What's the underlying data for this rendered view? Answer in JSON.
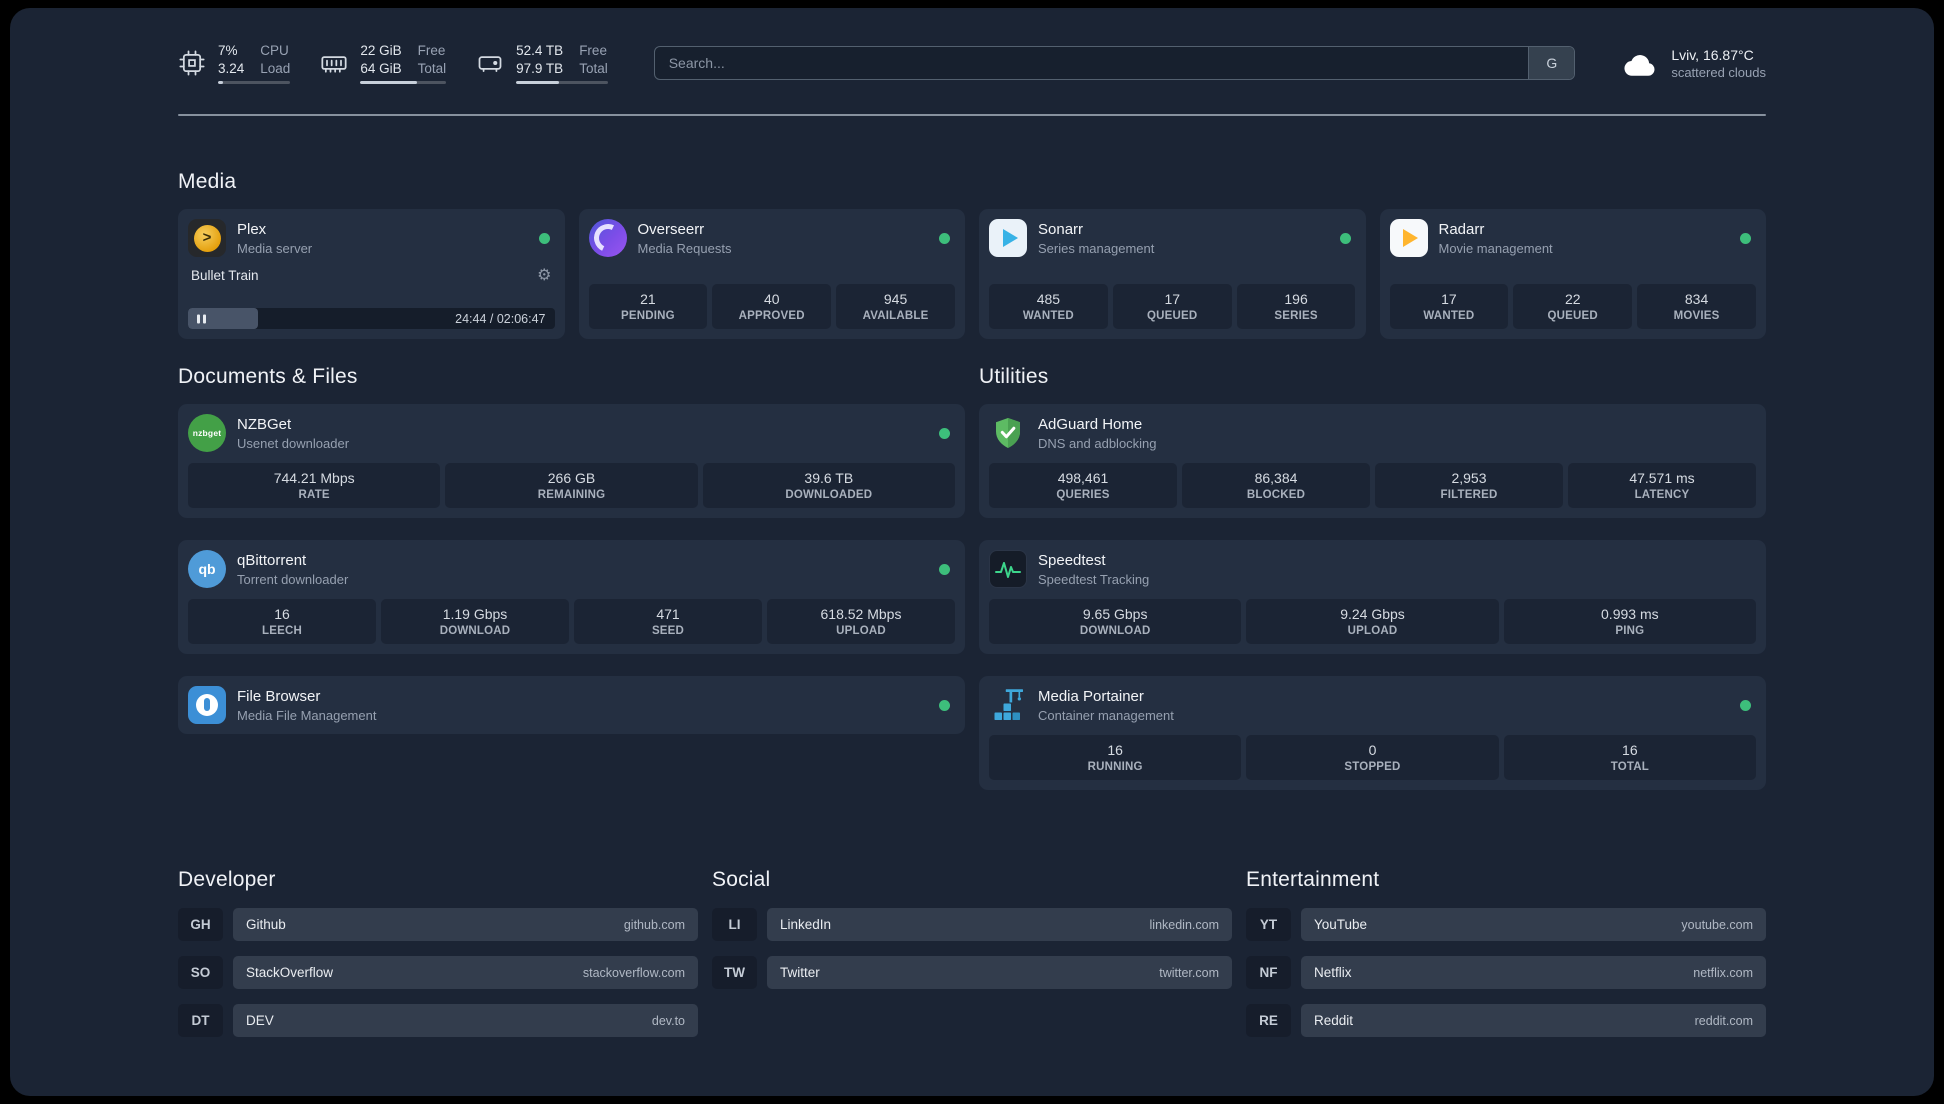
{
  "colors": {
    "background": "#1B2434",
    "card": "#242F41",
    "tile": "#1B2434",
    "status_online": "#3DBE7B",
    "plex_accent": "#E5A00D",
    "sonarr_accent": "#37B2E6",
    "radarr_accent": "#FFB52E",
    "overseerr_accent": "#7C4DE8",
    "nzbget_accent": "#43A047",
    "qbittorrent_accent": "#4F9BD8",
    "filebrowser_accent": "#3C8FD6",
    "adguard_accent": "#5DBB63",
    "speedtest_accent": "#3DD68C",
    "portainer_accent": "#3EA8DC"
  },
  "icons": {
    "settings_glyph": "⚙"
  },
  "topbar": {
    "cpu": {
      "value1": "7%",
      "label1": "CPU",
      "value2": "3.24",
      "label2": "Load",
      "usage_percent": 7
    },
    "memory": {
      "value1": "22 GiB",
      "label1": "Free",
      "value2": "64 GiB",
      "label2": "Total",
      "usage_percent": 66
    },
    "disk": {
      "value1": "52.4 TB",
      "label1": "Free",
      "value2": "97.9 TB",
      "label2": "Total",
      "usage_percent": 47
    },
    "search": {
      "placeholder": "Search...",
      "provider_label": "G"
    },
    "weather": {
      "location": "Lviv, 16.87°C",
      "condition": "scattered clouds"
    }
  },
  "section_titles": {
    "media": "Media",
    "documents": "Documents & Files",
    "utilities": "Utilities",
    "developer": "Developer",
    "social": "Social",
    "entertainment": "Entertainment"
  },
  "services": {
    "plex": {
      "name": "Plex",
      "desc": "Media server",
      "status": "online",
      "icon_text": ">",
      "now_playing": "Bullet Train",
      "time": "24:44 / 02:06:47",
      "progress_percent": 19
    },
    "overseerr": {
      "name": "Overseerr",
      "desc": "Media Requests",
      "status": "online",
      "stats": [
        {
          "value": "21",
          "label": "PENDING"
        },
        {
          "value": "40",
          "label": "APPROVED"
        },
        {
          "value": "945",
          "label": "AVAILABLE"
        }
      ]
    },
    "sonarr": {
      "name": "Sonarr",
      "desc": "Series management",
      "status": "online",
      "stats": [
        {
          "value": "485",
          "label": "WANTED"
        },
        {
          "value": "17",
          "label": "QUEUED"
        },
        {
          "value": "196",
          "label": "SERIES"
        }
      ]
    },
    "radarr": {
      "name": "Radarr",
      "desc": "Movie management",
      "status": "online",
      "stats": [
        {
          "value": "17",
          "label": "WANTED"
        },
        {
          "value": "22",
          "label": "QUEUED"
        },
        {
          "value": "834",
          "label": "MOVIES"
        }
      ]
    },
    "nzbget": {
      "name": "NZBGet",
      "desc": "Usenet downloader",
      "status": "online",
      "icon_text": "nzbget",
      "stats": [
        {
          "value": "744.21 Mbps",
          "label": "RATE"
        },
        {
          "value": "266 GB",
          "label": "REMAINING"
        },
        {
          "value": "39.6 TB",
          "label": "DOWNLOADED"
        }
      ]
    },
    "qbittorrent": {
      "name": "qBittorrent",
      "desc": "Torrent downloader",
      "status": "online",
      "icon_text": "qb",
      "stats": [
        {
          "value": "16",
          "label": "LEECH"
        },
        {
          "value": "1.19 Gbps",
          "label": "DOWNLOAD"
        },
        {
          "value": "471",
          "label": "SEED"
        },
        {
          "value": "618.52 Mbps",
          "label": "UPLOAD"
        }
      ]
    },
    "filebrowser": {
      "name": "File Browser",
      "desc": "Media File Management",
      "status": "online"
    },
    "adguard": {
      "name": "AdGuard Home",
      "desc": "DNS and adblocking",
      "stats": [
        {
          "value": "498,461",
          "label": "QUERIES"
        },
        {
          "value": "86,384",
          "label": "BLOCKED"
        },
        {
          "value": "2,953",
          "label": "FILTERED"
        },
        {
          "value": "47.571 ms",
          "label": "LATENCY"
        }
      ]
    },
    "speedtest": {
      "name": "Speedtest",
      "desc": "Speedtest Tracking",
      "stats": [
        {
          "value": "9.65 Gbps",
          "label": "DOWNLOAD"
        },
        {
          "value": "9.24 Gbps",
          "label": "UPLOAD"
        },
        {
          "value": "0.993 ms",
          "label": "PING"
        }
      ]
    },
    "portainer": {
      "name": "Media Portainer",
      "desc": "Container management",
      "status": "online",
      "stats": [
        {
          "value": "16",
          "label": "RUNNING"
        },
        {
          "value": "0",
          "label": "STOPPED"
        },
        {
          "value": "16",
          "label": "TOTAL"
        }
      ]
    }
  },
  "bookmarks": {
    "developer": [
      {
        "abbr": "GH",
        "name": "Github",
        "url": "github.com"
      },
      {
        "abbr": "SO",
        "name": "StackOverflow",
        "url": "stackoverflow.com"
      },
      {
        "abbr": "DT",
        "name": "DEV",
        "url": "dev.to"
      }
    ],
    "social": [
      {
        "abbr": "LI",
        "name": "LinkedIn",
        "url": "linkedin.com"
      },
      {
        "abbr": "TW",
        "name": "Twitter",
        "url": "twitter.com"
      }
    ],
    "entertainment": [
      {
        "abbr": "YT",
        "name": "YouTube",
        "url": "youtube.com"
      },
      {
        "abbr": "NF",
        "name": "Netflix",
        "url": "netflix.com"
      },
      {
        "abbr": "RE",
        "name": "Reddit",
        "url": "reddit.com"
      }
    ]
  }
}
